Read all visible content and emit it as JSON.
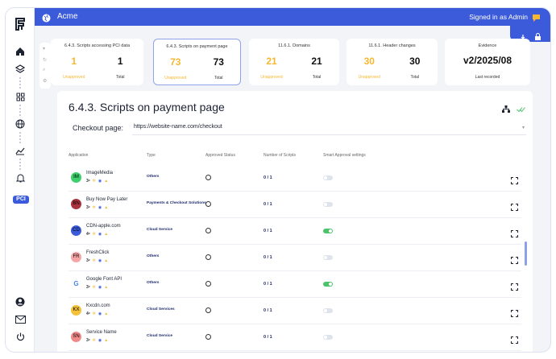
{
  "topbar": {
    "app_name": "Acme",
    "signed_in": "Signed in as Admin"
  },
  "sidebar": {
    "badge": "PCI"
  },
  "stats": [
    {
      "title": "6.4.3. Scripts accessing PCI data",
      "unapproved": "1",
      "total": "1",
      "unapproved_label": "Unapproved",
      "total_label": "Total"
    },
    {
      "title": "6.4.3. Scripts on payment page",
      "unapproved": "73",
      "total": "73",
      "unapproved_label": "Unapproved",
      "total_label": "Total"
    },
    {
      "title": "11.6.1. Domains",
      "unapproved": "21",
      "total": "21",
      "unapproved_label": "Unapproved",
      "total_label": "Total"
    },
    {
      "title": "11.6.1. Header changes",
      "unapproved": "30",
      "total": "30",
      "unapproved_label": "Unapproved",
      "total_label": "Total"
    }
  ],
  "evidence": {
    "title": "Evidence",
    "value": "v2/2025/08",
    "label": "Last recorded"
  },
  "main": {
    "title": "6.4.3. Scripts on payment page",
    "checkout_label": "Checkout page:",
    "checkout_url": "https://website-name.com/checkout",
    "columns": [
      "Application",
      "Type",
      "Approved Status",
      "Number of Scripts",
      "Smart Approval settings"
    ],
    "rows": [
      {
        "initials": "IM",
        "avatar_color": "#3ccf6b",
        "name": "ImageMedia",
        "version": "3",
        "type": "Others",
        "scripts": "0 / 1",
        "toggle": "off"
      },
      {
        "initials": "BN",
        "avatar_color": "#a8323e",
        "name": "Buy Now Pay Later",
        "version": "3",
        "type": "Payments & Checkout Solutions",
        "scripts": "0 / 1",
        "toggle": "off"
      },
      {
        "initials": "CD",
        "avatar_color": "#3b5bdb",
        "name": "CDN-apple.com",
        "version": "4",
        "type": "Cloud Service",
        "scripts": "0 / 1",
        "toggle": "on"
      },
      {
        "initials": "FR",
        "avatar_color": "#f4a6a6",
        "name": "FreshClick",
        "version": "3",
        "type": "Others",
        "scripts": "0 / 1",
        "toggle": "off"
      },
      {
        "initials": "G",
        "avatar_color": "#ffffff",
        "name": "Google Font API",
        "version": "3",
        "type": "Others",
        "scripts": "0 / 1",
        "toggle": "on"
      },
      {
        "initials": "KX",
        "avatar_color": "#f3c13a",
        "name": "Kxcdn.com",
        "version": "4",
        "type": "Cloud Services",
        "scripts": "0 / 1",
        "toggle": "off"
      },
      {
        "initials": "SN",
        "avatar_color": "#f08a8a",
        "name": "Service Name",
        "version": "3",
        "type": "Cloud Service",
        "scripts": "0 / 1",
        "toggle": "off"
      }
    ]
  }
}
